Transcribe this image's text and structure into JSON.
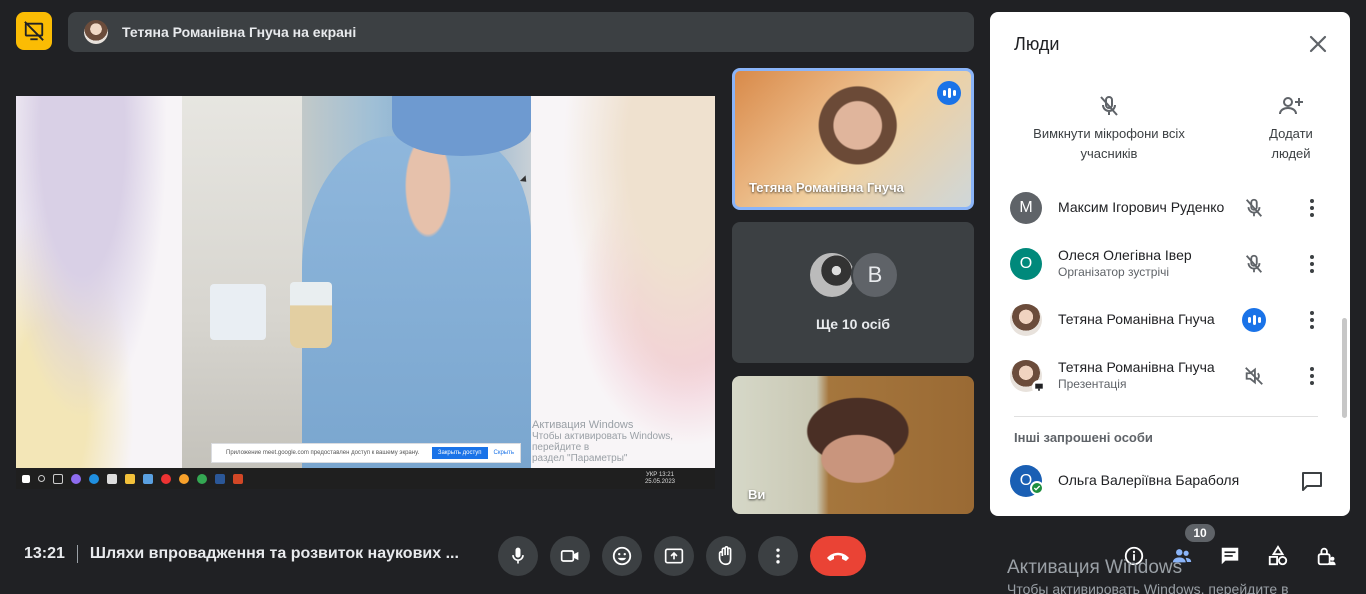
{
  "banner": {
    "title": "Тетяна Романівна Гнуча на екрані"
  },
  "main_share": {
    "notification": {
      "text": "Приложение meet.google.com предоставлен доступ к вашему экрану.",
      "stop_label": "Закрыть доступ",
      "hide_label": "Скрыть"
    },
    "activation": {
      "line1": "Активация Windows",
      "line2": "Чтобы активировать Windows, перейдите в",
      "line3": "раздел \"Параметры\""
    },
    "taskbar_time": "13:21",
    "taskbar_date": "25.05.2023",
    "taskbar_lang": "УКР"
  },
  "tiles": [
    {
      "name": "Тетяна Романівна Гнуча"
    },
    {
      "more_label": "Ще 10 осіб",
      "avatar_letter": "В"
    },
    {
      "name": "Ви"
    }
  ],
  "people_panel": {
    "title": "Люди",
    "mute_all_label": "Вимкнути мікрофони всіх учасників",
    "add_people_label": "Додати людей",
    "participants": [
      {
        "name": "Максим Ігорович Руденко",
        "role": "",
        "avatar_letter": "М",
        "avatar_color": "#5f6368",
        "mic": "muted"
      },
      {
        "name": "Олеся Олегівна Івер",
        "role": "Організатор зустрічі",
        "avatar_letter": "О",
        "avatar_color": "#00897b",
        "mic": "muted"
      },
      {
        "name": "Тетяна Романівна Гнуча",
        "role": "",
        "avatar_letter": "",
        "mic": "speaking"
      },
      {
        "name": "Тетяна Романівна Гнуча",
        "role": "Презентація",
        "avatar_letter": "",
        "mic": "audio-off"
      }
    ],
    "invited_section": "Інші запрошені особи",
    "invited": [
      {
        "name": "Ольга Валеріївна Бараболя",
        "avatar_letter": "О",
        "avatar_color": "#1a5fb4"
      }
    ]
  },
  "bottom": {
    "time": "13:21",
    "meeting_title": "Шляхи впровадження та розвиток наукових ...",
    "people_count": "10",
    "activation_line1": "Активация Windows",
    "activation_line2": "Чтобы активировать Windows, перейдите в"
  },
  "colors": {
    "accent": "#1a73e8",
    "end_call": "#ea4335",
    "present_badge": "#fbbc04",
    "speaking_border": "#8ab4f8"
  }
}
